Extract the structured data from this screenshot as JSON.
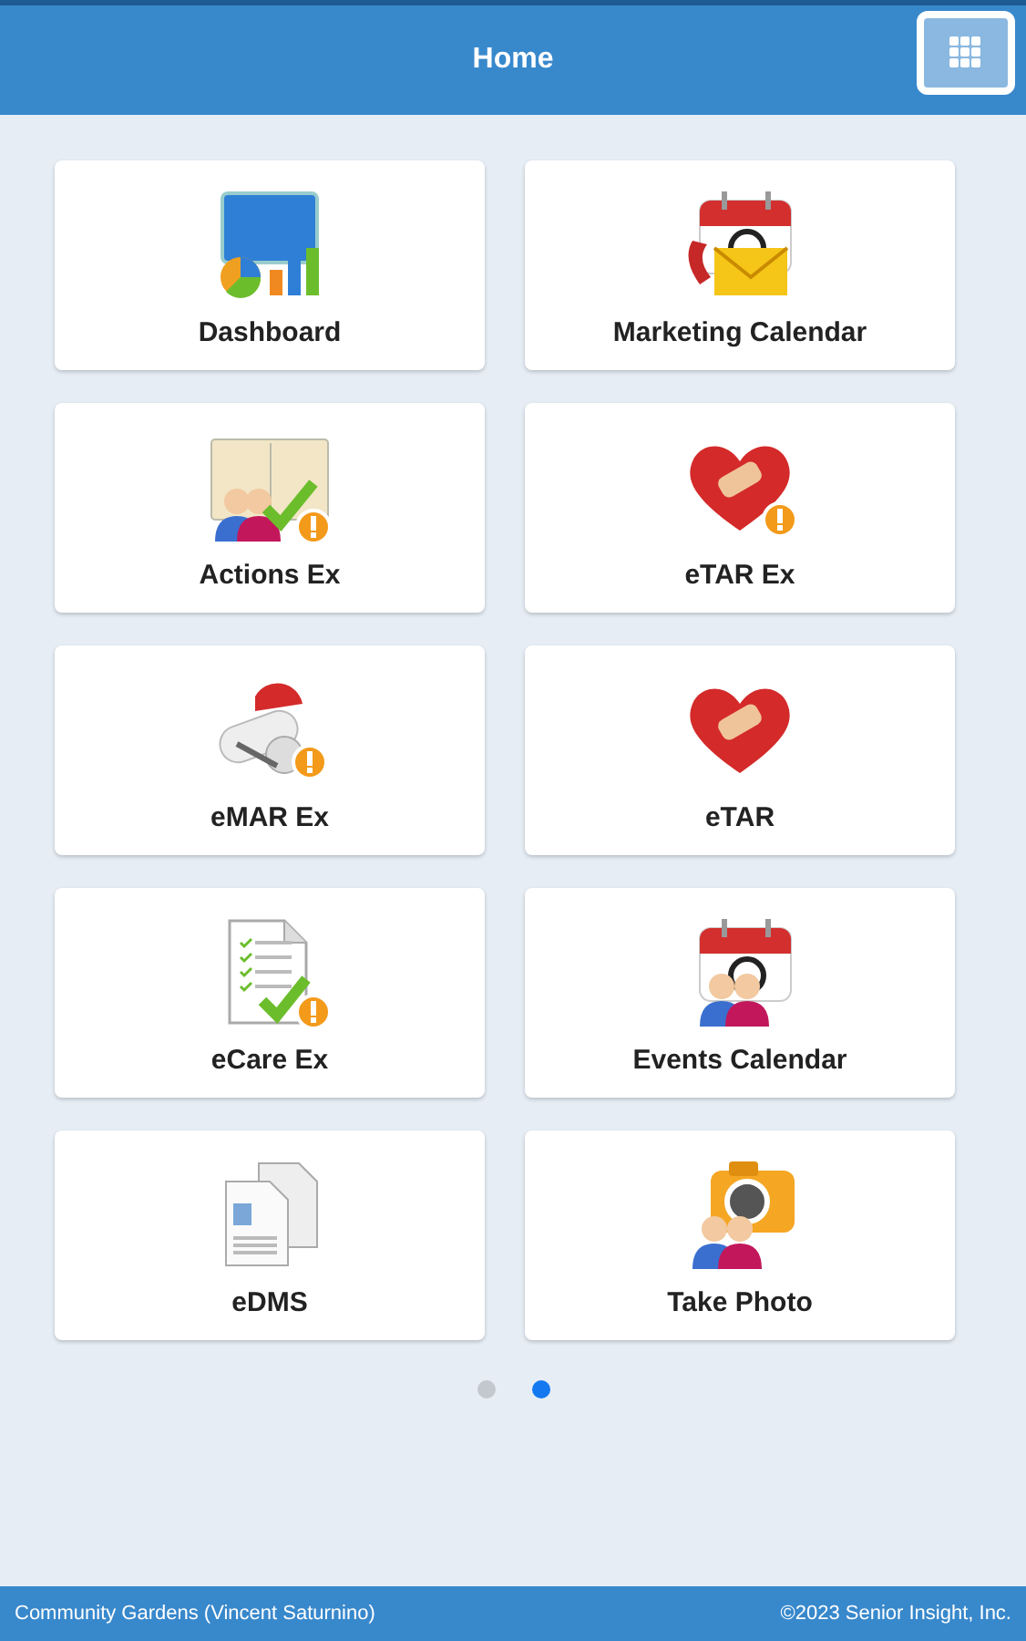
{
  "header": {
    "title": "Home"
  },
  "tiles": [
    {
      "label": "Dashboard",
      "kind": "dashboard"
    },
    {
      "label": "Marketing Calendar",
      "kind": "calendar-mail"
    },
    {
      "label": "Actions Ex",
      "kind": "actions"
    },
    {
      "label": "eTAR Ex",
      "kind": "heart-alert"
    },
    {
      "label": "eMAR Ex",
      "kind": "pills"
    },
    {
      "label": "eTAR",
      "kind": "heart"
    },
    {
      "label": "eCare Ex",
      "kind": "document"
    },
    {
      "label": "Events Calendar",
      "kind": "calendar-people"
    },
    {
      "label": "eDMS",
      "kind": "files"
    },
    {
      "label": "Take Photo",
      "kind": "camera"
    }
  ],
  "pages": [
    {
      "selected": false
    },
    {
      "selected": true
    }
  ],
  "footer": {
    "left": "Community Gardens (Vincent Saturnino)",
    "right": "©2023 Senior Insight, Inc."
  }
}
